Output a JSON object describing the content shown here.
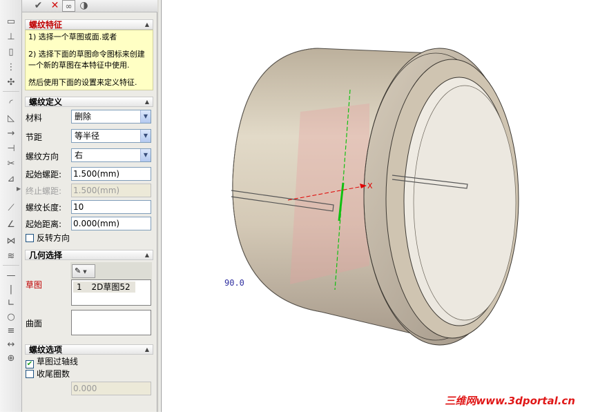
{
  "toolbar": {
    "ok_icon": "check-icon",
    "cancel_icon": "close-icon",
    "preview_icon": "glasses-icon",
    "shade_icon": "half-circle-icon"
  },
  "help": {
    "title": "螺纹特征",
    "line1": "1) 选择一个草图或面.或者",
    "line2": "2) 选择下面的草图命令图标来创建一个新的草图在本特征中使用.",
    "line3": "然后使用下面的设置来定义特征."
  },
  "thread_def": {
    "title": "螺纹定义",
    "material_label": "材料",
    "material_value": "删除",
    "pitch_label": "节距",
    "pitch_value": "等半径",
    "direction_label": "螺纹方向",
    "direction_value": "右",
    "start_pitch_label": "起始螺距:",
    "start_pitch_value": "1.500(mm)",
    "end_pitch_label": "终止螺距:",
    "end_pitch_value": "1.500(mm)",
    "length_label": "螺纹长度:",
    "length_value": "10",
    "start_dist_label": "起始距离:",
    "start_dist_value": "0.000(mm)",
    "reverse_label": "反转方向",
    "reverse_checked": false
  },
  "geometry": {
    "title": "几何选择",
    "sketch_label": "草图",
    "sketch_items": [
      {
        "index": "1",
        "name": "2D草图52"
      }
    ],
    "face_label": "曲面"
  },
  "thread_options": {
    "title": "螺纹选项",
    "through_axis_label": "草图过轴线",
    "through_axis_checked": true,
    "tail_label": "收尾圈数",
    "tail_checked": false,
    "tail_value": "0.000"
  },
  "viewport": {
    "dimension_text": "90.0",
    "axis_label": "X",
    "watermark": "三维网www.3dportal.cn"
  },
  "colors": {
    "accent_red": "#c00000",
    "help_bg": "#ffffc4",
    "panel_bg": "#ecebe6",
    "model_tan": "#cbbfab"
  }
}
